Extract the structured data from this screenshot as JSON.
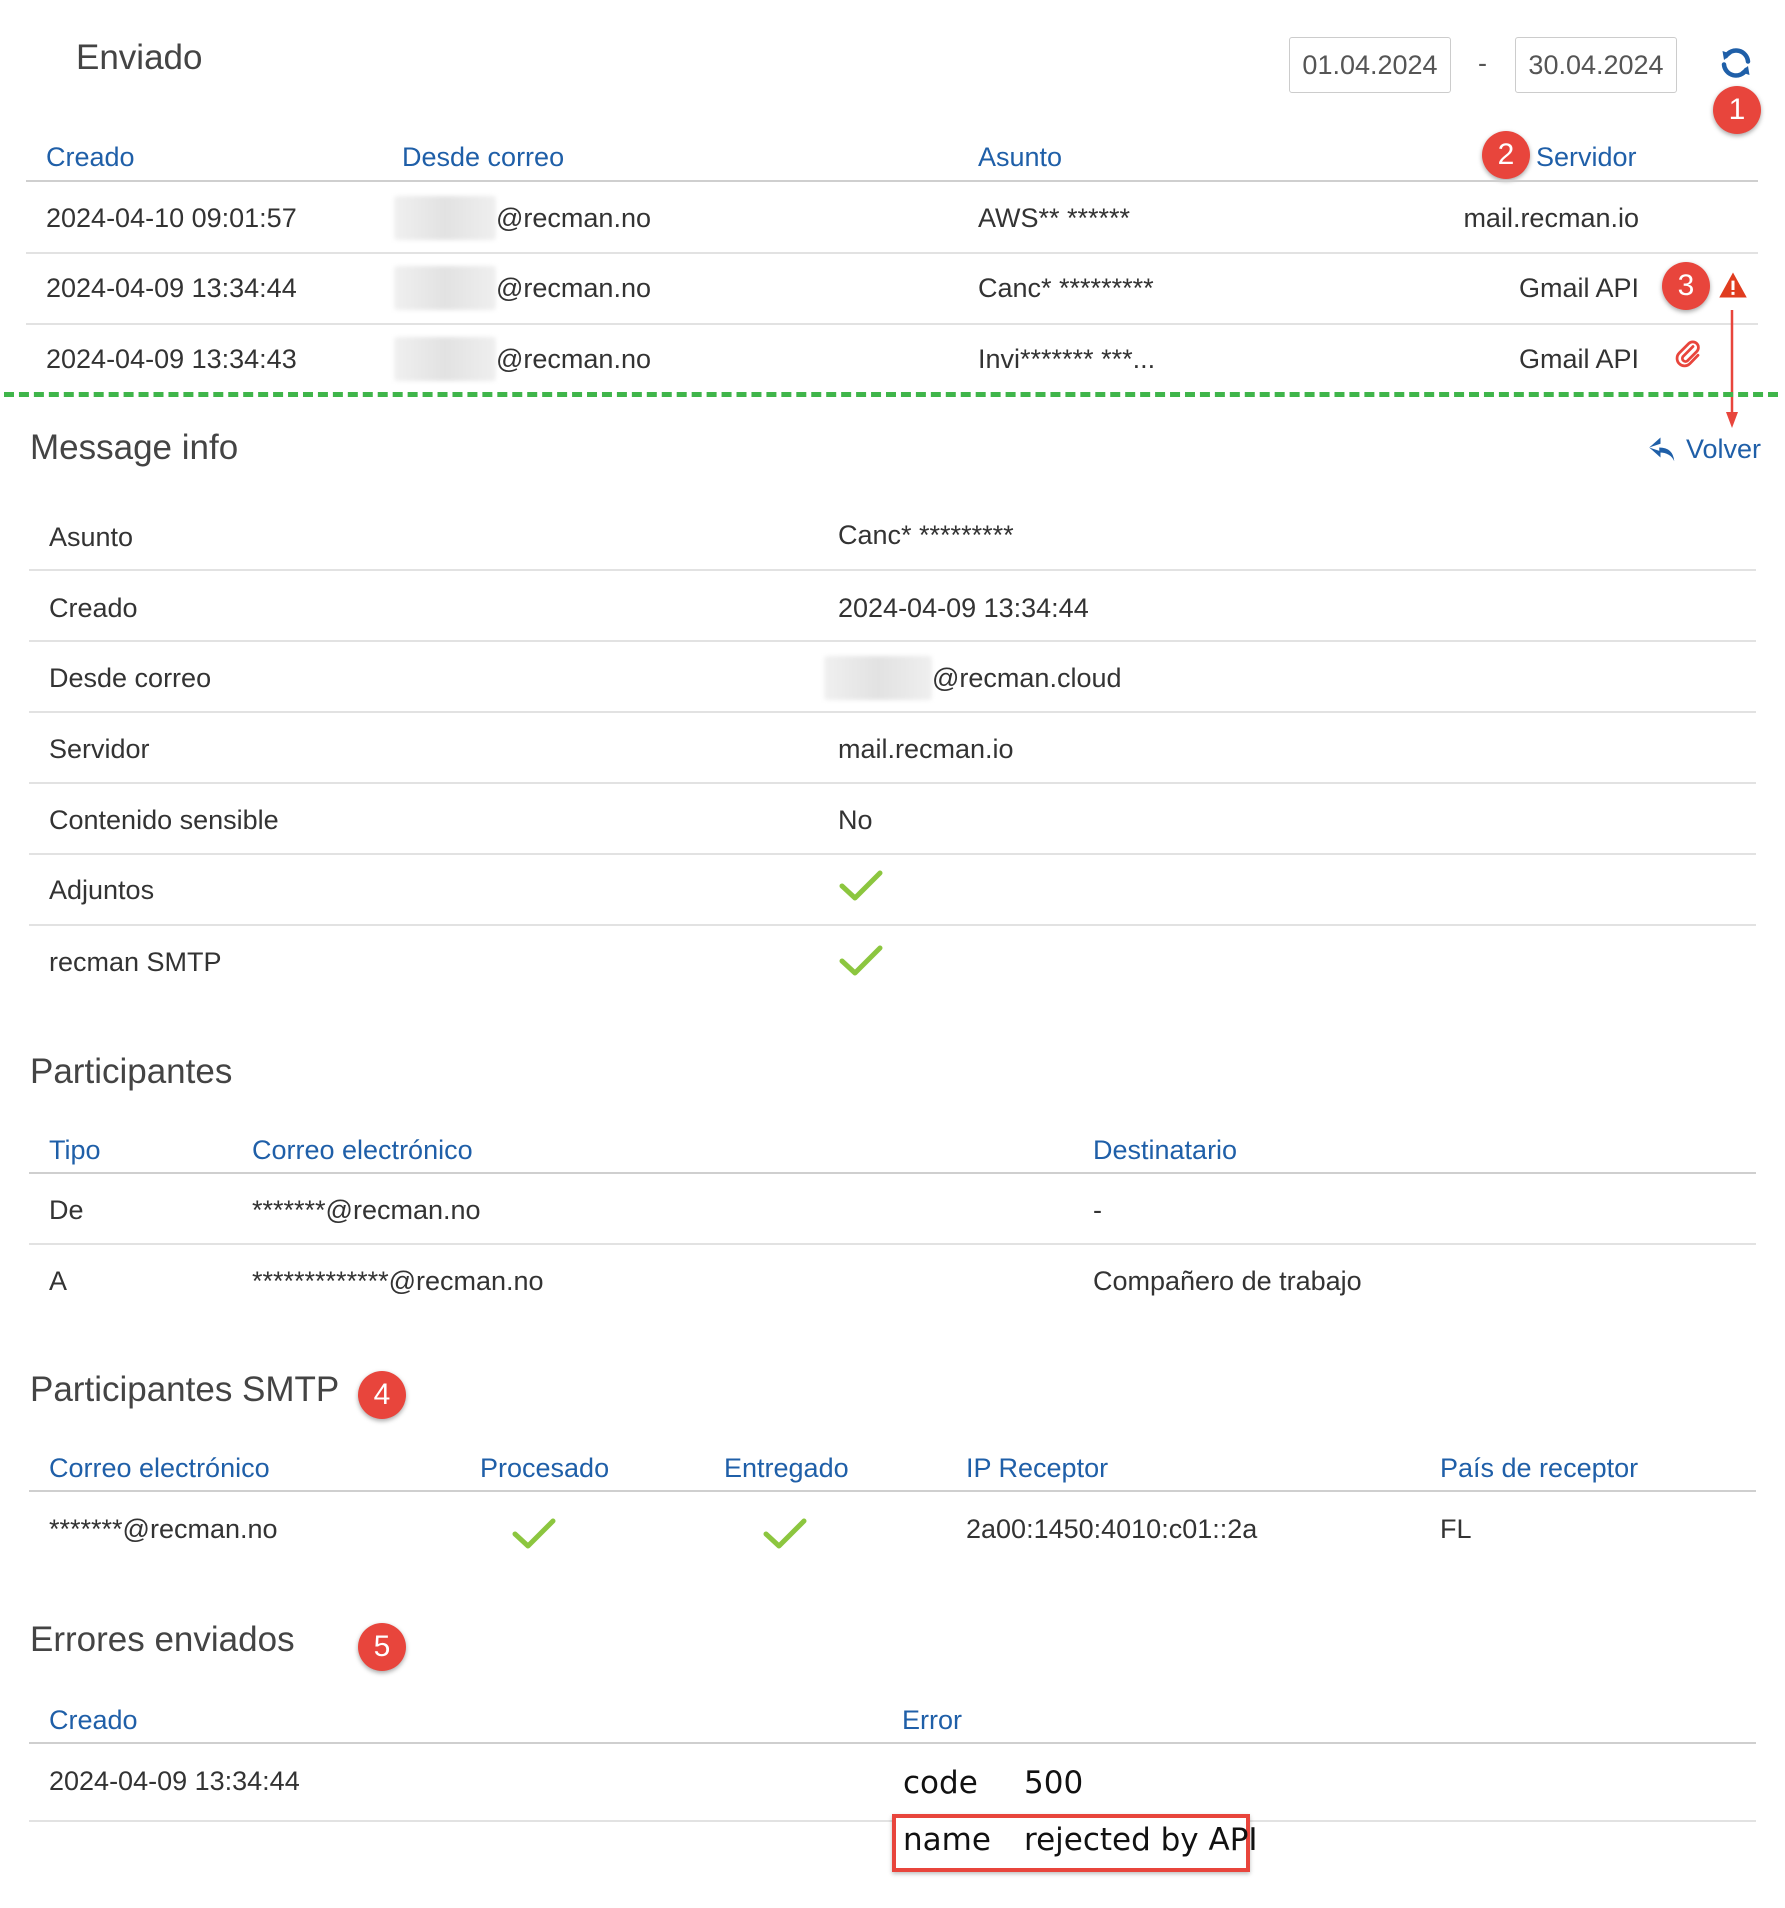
{
  "header": {
    "title": "Enviado",
    "date_from": "01.04.2024",
    "date_sep": "-",
    "date_to": "30.04.2024"
  },
  "sent_table": {
    "columns": [
      "Creado",
      "Desde correo",
      "Asunto",
      "Servidor"
    ],
    "rows": [
      {
        "created": "2024-04-10 09:01:57",
        "from": "@recman.no",
        "subject": "AWS** ******",
        "server": "mail.recman.io"
      },
      {
        "created": "2024-04-09 13:34:44",
        "from": "@recman.no",
        "subject": "Canc* *********",
        "server": "Gmail API"
      },
      {
        "created": "2024-04-09 13:34:43",
        "from": "@recman.no",
        "subject": "Invi******* ***...",
        "server": "Gmail API"
      }
    ]
  },
  "badges": [
    "1",
    "2",
    "3",
    "4",
    "5"
  ],
  "message_info": {
    "title": "Message info",
    "back_label": "Volver",
    "rows": [
      {
        "label": "Asunto",
        "value": "Canc* *********"
      },
      {
        "label": "Creado",
        "value": "2024-04-09 13:34:44"
      },
      {
        "label": "Desde correo",
        "value": "@recman.cloud"
      },
      {
        "label": "Servidor",
        "value": "mail.recman.io"
      },
      {
        "label": "Contenido sensible",
        "value": "No"
      },
      {
        "label": "Adjuntos",
        "value": ""
      },
      {
        "label": "recman SMTP",
        "value": ""
      }
    ]
  },
  "participants": {
    "title": "Participantes",
    "columns": [
      "Tipo",
      "Correo electrónico",
      "Destinatario"
    ],
    "rows": [
      {
        "type": "De",
        "email": "*******@recman.no",
        "recipient": "-"
      },
      {
        "type": "A",
        "email": "*************@recman.no",
        "recipient": "Compañero de trabajo"
      }
    ]
  },
  "smtp_participants": {
    "title": "Participantes SMTP",
    "columns": [
      "Correo electrónico",
      "Procesado",
      "Entregado",
      "IP Receptor",
      "País de receptor"
    ],
    "rows": [
      {
        "email": "*******@recman.no",
        "ip": "2a00:1450:4010:c01::2a",
        "country": "FL"
      }
    ]
  },
  "errors": {
    "title": "Errores enviados",
    "columns": [
      "Creado",
      "Error"
    ],
    "rows": [
      {
        "created": "2024-04-09 13:34:44",
        "code_key": "code",
        "code_value": "500",
        "name_key": "name",
        "name_value": "rejected by API"
      }
    ]
  },
  "colors": {
    "accent": "#1f5fa8",
    "badge": "#e8453c",
    "check": "#8cc63f",
    "warning": "#e03c1f",
    "divider_dashed": "#3fb54a",
    "highlight_box": "#e8453c"
  },
  "icons": [
    "refresh-icon",
    "warning-icon",
    "paperclip-icon",
    "reply-arrow-icon",
    "check-icon"
  ]
}
